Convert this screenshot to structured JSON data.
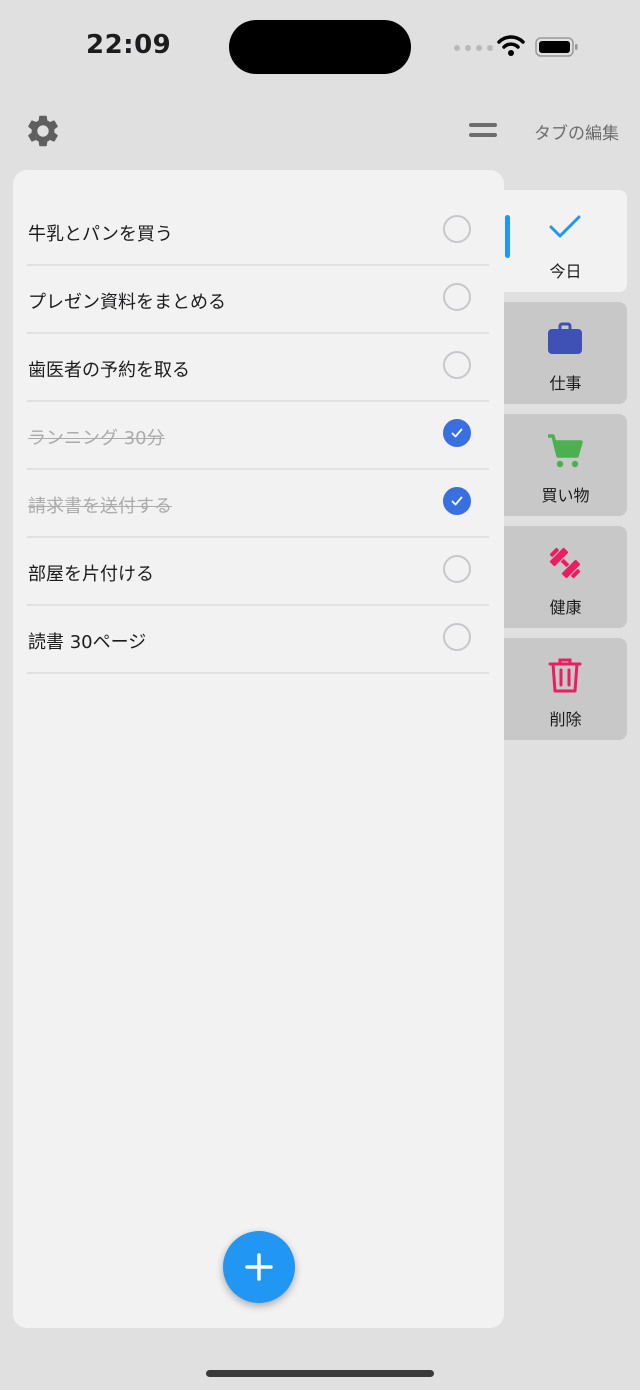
{
  "status_bar": {
    "time": "22:09"
  },
  "header": {
    "tab_edit_label": "タブの編集"
  },
  "tasks": [
    {
      "label": "牛乳とパンを買う",
      "done": false
    },
    {
      "label": "プレゼン資料をまとめる",
      "done": false
    },
    {
      "label": "歯医者の予約を取る",
      "done": false
    },
    {
      "label": "ランニング 30分",
      "done": true
    },
    {
      "label": "請求書を送付する",
      "done": true
    },
    {
      "label": "部屋を片付ける",
      "done": false
    },
    {
      "label": "読書 30ページ",
      "done": false
    }
  ],
  "sidebar": {
    "tabs": [
      {
        "label": "今日",
        "icon": "checkmark-icon",
        "color": "#2196f3",
        "active": true
      },
      {
        "label": "仕事",
        "icon": "briefcase-icon",
        "color": "#3f51b5",
        "active": false
      },
      {
        "label": "買い物",
        "icon": "cart-icon",
        "color": "#4caf50",
        "active": false
      },
      {
        "label": "健康",
        "icon": "dumbbell-icon",
        "color": "#e91e63",
        "active": false
      },
      {
        "label": "削除",
        "icon": "trash-icon",
        "color": "#e91e63",
        "active": false
      }
    ]
  },
  "colors": {
    "accent": "#2196f3",
    "check": "#3a6fe0"
  }
}
